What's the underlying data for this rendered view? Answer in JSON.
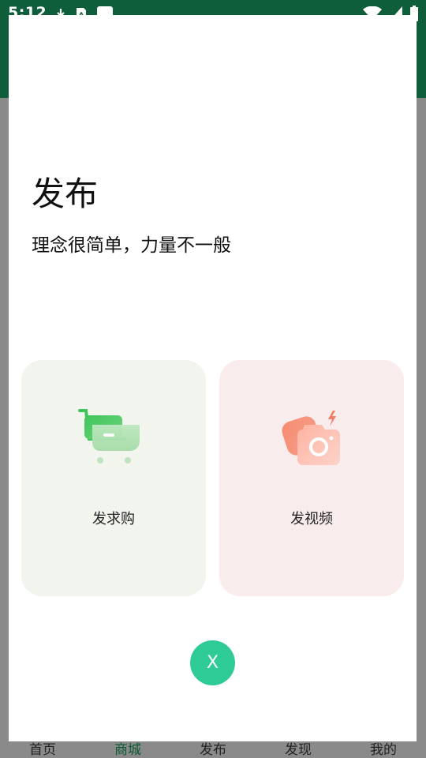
{
  "status_bar": {
    "time": "5:12"
  },
  "bottom_nav": {
    "items": [
      {
        "label": "首页"
      },
      {
        "label": "商城"
      },
      {
        "label": "发布"
      },
      {
        "label": "发现"
      },
      {
        "label": "我的"
      }
    ],
    "active_index": 1
  },
  "modal": {
    "title": "发布",
    "subtitle": "理念很简单，力量不一般",
    "cards": [
      {
        "label": "发求购",
        "icon": "shopping-cart-icon",
        "background": "#f2f4ee"
      },
      {
        "label": "发视频",
        "icon": "camera-icon",
        "background": "#f9ecec"
      }
    ],
    "close_label": "X"
  },
  "colors": {
    "status_bar": "#0f5e3b",
    "accent": "#2ecb96",
    "overlay": "#8a8a8a",
    "active_nav": "#0d5c36"
  }
}
